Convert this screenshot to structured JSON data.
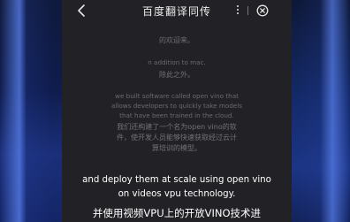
{
  "header": {
    "title": "百度翻译同传",
    "back_icon": "chevron-left-icon",
    "more_icon": "vertical-dots-icon",
    "close_icon": "circle-x-icon"
  },
  "transcript": {
    "faded": [
      {
        "lang": "zh",
        "text": "的欢迎来。"
      },
      {
        "lang": "en",
        "text": "n addition to mac."
      },
      {
        "lang": "zh",
        "text": "除此之外。"
      },
      {
        "lang": "en",
        "text": "we built software called open vino that"
      },
      {
        "lang": "en",
        "text": "allows developers to quickly take models"
      },
      {
        "lang": "en",
        "text": "that have been trained in the cloud."
      },
      {
        "lang": "zh",
        "text": "我们还构建了一个名为open vino的软"
      },
      {
        "lang": "zh",
        "text": "件，使开发人员能够快速获取经过云计"
      },
      {
        "lang": "zh",
        "text": "算培训的模型。"
      }
    ],
    "current_en": [
      "and deploy them at scale using open vino",
      "on videos vpu technology."
    ],
    "current_zh": "并使用视频VPU上的开放VINO技术进"
  },
  "colors": {
    "panel_bg": "#222226",
    "faded_text": "#6b6b6e",
    "current_text": "#ffffff",
    "side_glow": "#5a82f0"
  }
}
